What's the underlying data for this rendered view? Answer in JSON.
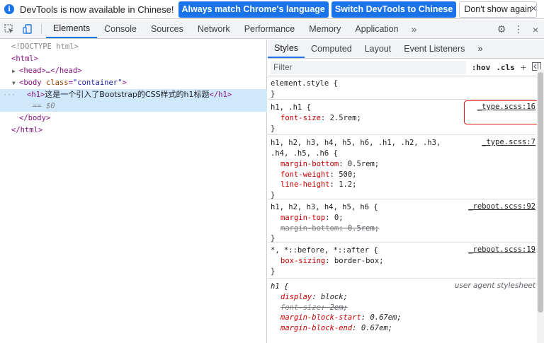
{
  "infobar": {
    "message": "DevTools is now available in Chinese!",
    "btn_match": "Always match Chrome's language",
    "btn_switch": "Switch DevTools to Chinese",
    "btn_dismiss": "Don't show again",
    "close": "×"
  },
  "toolbar": {
    "tabs": [
      "Elements",
      "Console",
      "Sources",
      "Network",
      "Performance",
      "Memory",
      "Application"
    ],
    "more": "»",
    "gear": "⚙",
    "kebab": "⋮",
    "close": "×"
  },
  "dom": {
    "doctype": "<!DOCTYPE html>",
    "html_open": "<html>",
    "head_collapsed": "<head>…</head>",
    "body_tag": "body",
    "body_attr": "class",
    "body_attr_val": "\"container\"",
    "h1_open": "<h1>",
    "h1_text": "这是一个引入了Bootstrap的CSS样式的h1标题",
    "h1_close": "</h1>",
    "eq_ref": "== $0",
    "body_close": "</body>",
    "html_close": "</html>"
  },
  "styles": {
    "tabs": [
      "Styles",
      "Computed",
      "Layout",
      "Event Listeners"
    ],
    "more": "»",
    "filter_placeholder": "Filter",
    "hov": ":hov",
    "cls": ".cls",
    "plus": "+",
    "rules": [
      {
        "selector": "element.style {",
        "source": "",
        "decls": [],
        "close": "}"
      },
      {
        "selector": "h1, .h1 {",
        "source": "_type.scss:16",
        "decls": [
          {
            "p": "font-size",
            "v": "2.5rem;"
          }
        ],
        "close": "}"
      },
      {
        "selector": "h1, h2, h3, h4, h5, h6, .h1, .h2, .h3,",
        "selector2": ".h4, .h5, .h6 {",
        "source": "_type.scss:7",
        "decls": [
          {
            "p": "margin-bottom",
            "v": "0.5rem;"
          },
          {
            "p": "font-weight",
            "v": "500;"
          },
          {
            "p": "line-height",
            "v": "1.2;"
          }
        ],
        "close": "}"
      },
      {
        "selector": "h1, h2, h3, h4, h5, h6 {",
        "source": "_reboot.scss:92",
        "decls": [
          {
            "p": "margin-top",
            "v": "0;"
          },
          {
            "p": "margin-bottom",
            "v": "0.5rem;"
          }
        ],
        "close": "}"
      },
      {
        "selector": "*, *::before, *::after {",
        "source": "_reboot.scss:19",
        "decls": [
          {
            "p": "box-sizing",
            "v": "border-box;"
          }
        ],
        "close": "}"
      },
      {
        "selector": "h1 {",
        "source": "user agent stylesheet",
        "decls": [
          {
            "p": "display",
            "v": "block;"
          },
          {
            "p": "font-size",
            "v": "2em;"
          },
          {
            "p": "margin-block-start",
            "v": "0.67em;"
          },
          {
            "p": "margin-block-end",
            "v": "0.67em;"
          }
        ]
      }
    ]
  },
  "colors": {
    "accent": "#1a73e8",
    "highlight": "#e01616",
    "selected_row": "#cfe8fc"
  }
}
